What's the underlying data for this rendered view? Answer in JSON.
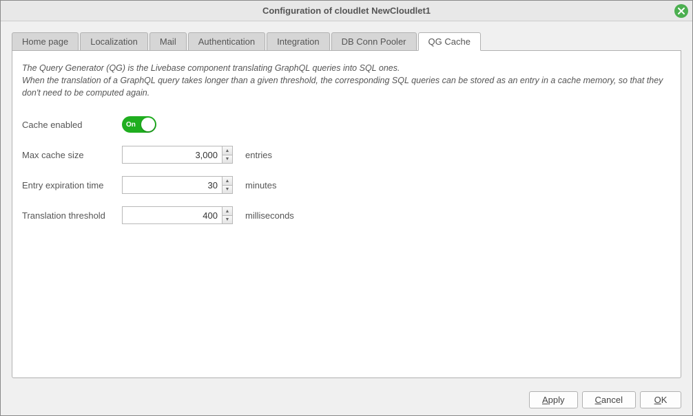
{
  "window": {
    "title": "Configuration of cloudlet NewCloudlet1"
  },
  "tabs": [
    {
      "label": "Home page",
      "active": false
    },
    {
      "label": "Localization",
      "active": false
    },
    {
      "label": "Mail",
      "active": false
    },
    {
      "label": "Authentication",
      "active": false
    },
    {
      "label": "Integration",
      "active": false
    },
    {
      "label": "DB Conn Pooler",
      "active": false
    },
    {
      "label": "QG Cache",
      "active": true
    }
  ],
  "panel": {
    "description_line1": "The Query Generator (QG) is the Livebase component translating GraphQL queries into SQL ones.",
    "description_line2": "When the translation of a GraphQL query takes longer than a given threshold, the corresponding SQL queries can be stored as an entry in a cache memory, so that they don't need to be computed again.",
    "cache_enabled_label": "Cache enabled",
    "toggle_state": "On",
    "fields": {
      "max_cache_size": {
        "label": "Max cache size",
        "value": "3,000",
        "unit": "entries"
      },
      "entry_expiration": {
        "label": "Entry expiration time",
        "value": "30",
        "unit": "minutes"
      },
      "translation_threshold": {
        "label": "Translation threshold",
        "value": "400",
        "unit": "milliseconds"
      }
    }
  },
  "buttons": {
    "apply": "Apply",
    "cancel": "Cancel",
    "ok": "OK"
  }
}
